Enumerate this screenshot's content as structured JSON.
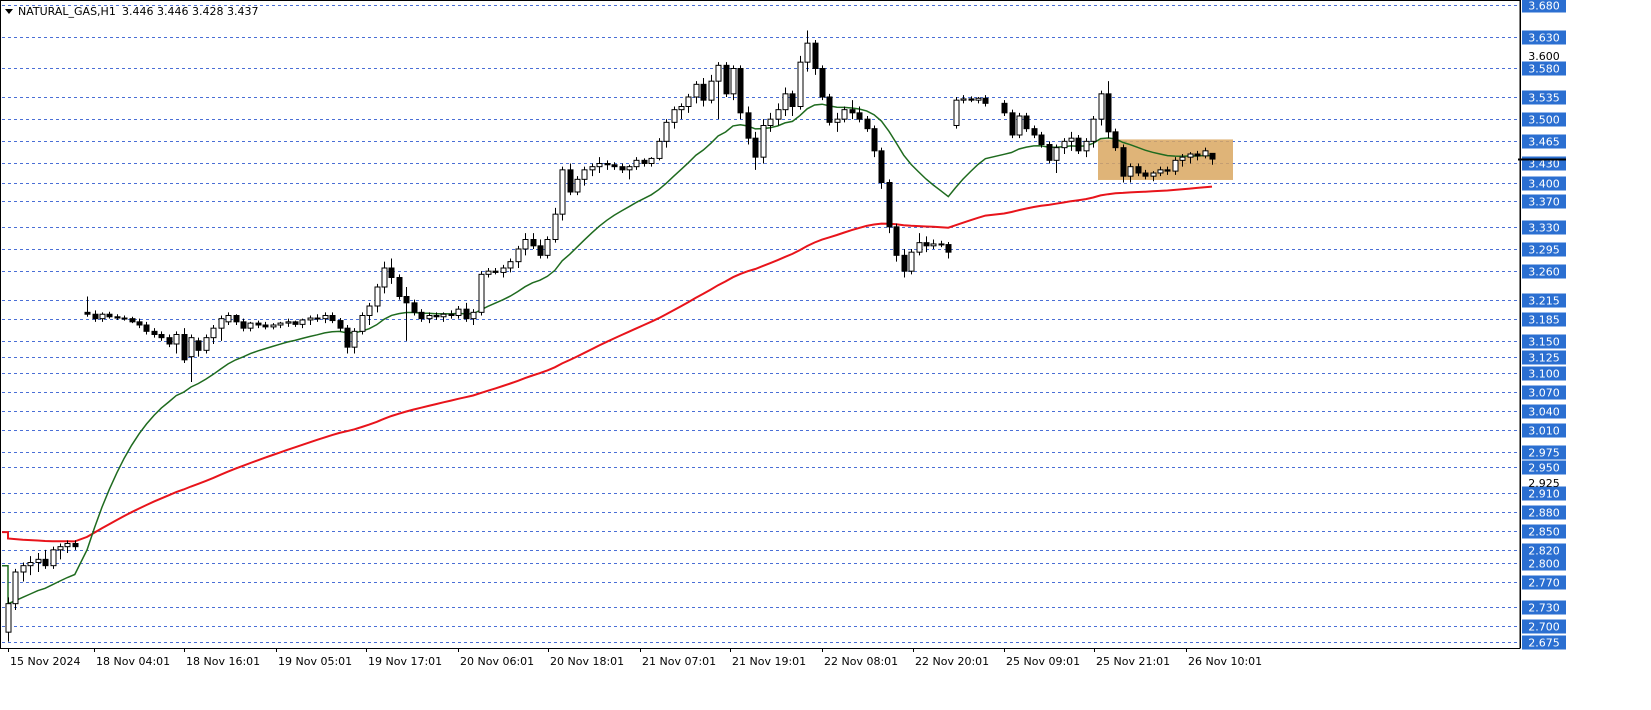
{
  "header": {
    "symbol_label": "NATURAL_GAS,H1",
    "ohlc_values": "3.446 3.446 3.428 3.437"
  },
  "colors": {
    "background": "#ffffff",
    "grid": "#4a6fd6",
    "bull_candle": "#ffffff",
    "bear_candle": "#000000",
    "candle_outline": "#000000",
    "ma_fast": "#1f6b1f",
    "ma_slow": "#e8141b",
    "price_tag_bg": "#2b6fd1",
    "price_tag_text": "#ffffff",
    "zone_fill": "#d9a760"
  },
  "chart_data": {
    "type": "candlestick",
    "instrument": "NATURAL_GAS",
    "timeframe": "H1",
    "ylim": [
      2.665,
      3.685
    ],
    "grid": "horizontal dashed at each price tag",
    "y_ticks_tagged": [
      "3.680",
      "3.630",
      "3.580",
      "3.535",
      "3.500",
      "3.465",
      "3.430",
      "3.400",
      "3.370",
      "3.330",
      "3.295",
      "3.260",
      "3.215",
      "3.185",
      "3.150",
      "3.125",
      "3.100",
      "3.070",
      "3.040",
      "3.010",
      "2.975",
      "2.950",
      "2.910",
      "2.880",
      "2.850",
      "2.820",
      "2.800",
      "2.770",
      "2.730",
      "2.700",
      "2.675"
    ],
    "y_ticks_plain": [
      "3.600",
      "2.925"
    ],
    "x_tick_labels": [
      "15 Nov 2024",
      "18 Nov 04:01",
      "18 Nov 16:01",
      "19 Nov 05:01",
      "19 Nov 17:01",
      "20 Nov 06:01",
      "20 Nov 18:01",
      "21 Nov 07:01",
      "21 Nov 19:01",
      "22 Nov 08:01",
      "22 Nov 20:01",
      "25 Nov 09:01",
      "25 Nov 21:01",
      "26 Nov 10:01"
    ],
    "current_price": "3.437",
    "candles": [
      [
        2.69,
        2.745,
        2.675,
        2.735
      ],
      [
        2.735,
        2.79,
        2.725,
        2.785
      ],
      [
        2.785,
        2.8,
        2.77,
        2.795
      ],
      [
        2.795,
        2.81,
        2.78,
        2.8
      ],
      [
        2.8,
        2.815,
        2.785,
        2.805
      ],
      [
        2.805,
        2.82,
        2.79,
        2.795
      ],
      [
        2.795,
        2.825,
        2.79,
        2.82
      ],
      [
        2.82,
        2.83,
        2.805,
        2.825
      ],
      [
        2.825,
        2.835,
        2.815,
        2.83
      ],
      [
        2.83,
        2.835,
        2.82,
        2.825
      ],
      [
        3.195,
        3.22,
        3.188,
        3.192
      ],
      [
        3.192,
        3.198,
        3.18,
        3.185
      ],
      [
        3.185,
        3.195,
        3.18,
        3.192
      ],
      [
        3.192,
        3.196,
        3.185,
        3.188
      ],
      [
        3.188,
        3.192,
        3.183,
        3.186
      ],
      [
        3.186,
        3.19,
        3.182,
        3.185
      ],
      [
        3.185,
        3.188,
        3.178,
        3.18
      ],
      [
        3.18,
        3.185,
        3.17,
        3.175
      ],
      [
        3.175,
        3.18,
        3.16,
        3.165
      ],
      [
        3.165,
        3.17,
        3.155,
        3.16
      ],
      [
        3.16,
        3.165,
        3.15,
        3.155
      ],
      [
        3.155,
        3.16,
        3.14,
        3.145
      ],
      [
        3.145,
        3.165,
        3.13,
        3.16
      ],
      [
        3.16,
        3.17,
        3.115,
        3.12
      ],
      [
        3.125,
        3.16,
        3.085,
        3.155
      ],
      [
        3.15,
        3.155,
        3.125,
        3.135
      ],
      [
        3.135,
        3.16,
        3.13,
        3.155
      ],
      [
        3.155,
        3.175,
        3.145,
        3.17
      ],
      [
        3.17,
        3.19,
        3.15,
        3.185
      ],
      [
        3.18,
        3.195,
        3.175,
        3.19
      ],
      [
        3.19,
        3.192,
        3.175,
        3.18
      ],
      [
        3.18,
        3.185,
        3.165,
        3.17
      ],
      [
        3.17,
        3.18,
        3.165,
        3.178
      ],
      [
        3.178,
        3.182,
        3.17,
        3.175
      ],
      [
        3.175,
        3.18,
        3.168,
        3.172
      ],
      [
        3.172,
        3.178,
        3.168,
        3.175
      ],
      [
        3.175,
        3.18,
        3.17,
        3.178
      ],
      [
        3.178,
        3.185,
        3.172,
        3.18
      ],
      [
        3.18,
        3.182,
        3.172,
        3.176
      ],
      [
        3.176,
        3.185,
        3.17,
        3.183
      ],
      [
        3.183,
        3.19,
        3.175,
        3.186
      ],
      [
        3.186,
        3.192,
        3.18,
        3.185
      ],
      [
        3.185,
        3.195,
        3.178,
        3.19
      ],
      [
        3.19,
        3.195,
        3.178,
        3.182
      ],
      [
        3.182,
        3.186,
        3.165,
        3.17
      ],
      [
        3.17,
        3.175,
        3.13,
        3.14
      ],
      [
        3.14,
        3.17,
        3.13,
        3.165
      ],
      [
        3.165,
        3.195,
        3.16,
        3.19
      ],
      [
        3.19,
        3.21,
        3.175,
        3.205
      ],
      [
        3.205,
        3.24,
        3.195,
        3.235
      ],
      [
        3.235,
        3.275,
        3.225,
        3.265
      ],
      [
        3.265,
        3.28,
        3.24,
        3.25
      ],
      [
        3.25,
        3.255,
        3.215,
        3.22
      ],
      [
        3.22,
        3.235,
        3.15,
        3.21
      ],
      [
        3.21,
        3.215,
        3.19,
        3.195
      ],
      [
        3.195,
        3.2,
        3.18,
        3.185
      ],
      [
        3.185,
        3.195,
        3.178,
        3.19
      ],
      [
        3.19,
        3.195,
        3.183,
        3.188
      ],
      [
        3.188,
        3.195,
        3.18,
        3.192
      ],
      [
        3.192,
        3.198,
        3.185,
        3.19
      ],
      [
        3.19,
        3.205,
        3.185,
        3.2
      ],
      [
        3.2,
        3.21,
        3.18,
        3.185
      ],
      [
        3.185,
        3.2,
        3.175,
        3.195
      ],
      [
        3.195,
        3.26,
        3.19,
        3.255
      ],
      [
        3.255,
        3.265,
        3.25,
        3.26
      ],
      [
        3.26,
        3.265,
        3.255,
        3.258
      ],
      [
        3.258,
        3.27,
        3.25,
        3.265
      ],
      [
        3.265,
        3.28,
        3.258,
        3.275
      ],
      [
        3.275,
        3.3,
        3.265,
        3.295
      ],
      [
        3.295,
        3.32,
        3.285,
        3.31
      ],
      [
        3.31,
        3.32,
        3.295,
        3.3
      ],
      [
        3.3,
        3.31,
        3.28,
        3.285
      ],
      [
        3.285,
        3.315,
        3.28,
        3.31
      ],
      [
        3.31,
        3.36,
        3.305,
        3.35
      ],
      [
        3.35,
        3.425,
        3.34,
        3.42
      ],
      [
        3.42,
        3.43,
        3.38,
        3.385
      ],
      [
        3.385,
        3.41,
        3.38,
        3.405
      ],
      [
        3.405,
        3.425,
        3.395,
        3.42
      ],
      [
        3.42,
        3.43,
        3.41,
        3.425
      ],
      [
        3.425,
        3.44,
        3.415,
        3.43
      ],
      [
        3.43,
        3.435,
        3.42,
        3.428
      ],
      [
        3.428,
        3.432,
        3.42,
        3.425
      ],
      [
        3.425,
        3.43,
        3.415,
        3.42
      ],
      [
        3.42,
        3.428,
        3.405,
        3.425
      ],
      [
        3.425,
        3.44,
        3.42,
        3.435
      ],
      [
        3.435,
        3.438,
        3.425,
        3.43
      ],
      [
        3.43,
        3.44,
        3.425,
        3.438
      ],
      [
        3.438,
        3.47,
        3.435,
        3.465
      ],
      [
        3.465,
        3.5,
        3.455,
        3.495
      ],
      [
        3.495,
        3.52,
        3.485,
        3.515
      ],
      [
        3.515,
        3.525,
        3.5,
        3.52
      ],
      [
        3.52,
        3.54,
        3.51,
        3.535
      ],
      [
        3.535,
        3.56,
        3.525,
        3.555
      ],
      [
        3.555,
        3.565,
        3.52,
        3.53
      ],
      [
        3.53,
        3.57,
        3.525,
        3.56
      ],
      [
        3.56,
        3.59,
        3.5,
        3.585
      ],
      [
        3.585,
        3.59,
        3.535,
        3.54
      ],
      [
        3.54,
        3.585,
        3.53,
        3.58
      ],
      [
        3.58,
        3.585,
        3.5,
        3.51
      ],
      [
        3.51,
        3.52,
        3.46,
        3.47
      ],
      [
        3.47,
        3.48,
        3.42,
        3.44
      ],
      [
        3.44,
        3.5,
        3.43,
        3.49
      ],
      [
        3.49,
        3.51,
        3.48,
        3.5
      ],
      [
        3.5,
        3.525,
        3.49,
        3.515
      ],
      [
        3.515,
        3.55,
        3.505,
        3.54
      ],
      [
        3.54,
        3.545,
        3.505,
        3.52
      ],
      [
        3.52,
        3.6,
        3.515,
        3.59
      ],
      [
        3.59,
        3.64,
        3.575,
        3.62
      ],
      [
        3.62,
        3.625,
        3.57,
        3.58
      ],
      [
        3.58,
        3.585,
        3.53,
        3.535
      ],
      [
        3.535,
        3.54,
        3.49,
        3.495
      ],
      [
        3.495,
        3.51,
        3.48,
        3.5
      ],
      [
        3.5,
        3.52,
        3.495,
        3.515
      ],
      [
        3.515,
        3.53,
        3.5,
        3.51
      ],
      [
        3.51,
        3.52,
        3.495,
        3.5
      ],
      [
        3.5,
        3.505,
        3.48,
        3.485
      ],
      [
        3.485,
        3.49,
        3.44,
        3.45
      ],
      [
        3.45,
        3.455,
        3.39,
        3.4
      ],
      [
        3.4,
        3.405,
        3.32,
        3.33
      ],
      [
        3.33,
        3.335,
        3.275,
        3.285
      ],
      [
        3.285,
        3.295,
        3.25,
        3.26
      ],
      [
        3.26,
        3.295,
        3.255,
        3.29
      ],
      [
        3.29,
        3.32,
        3.285,
        3.305
      ],
      [
        3.305,
        3.315,
        3.29,
        3.3
      ],
      [
        3.3,
        3.31,
        3.295,
        3.303
      ],
      [
        3.303,
        3.308,
        3.298,
        3.302
      ],
      [
        3.302,
        3.306,
        3.28,
        3.29
      ],
      [
        3.49,
        3.535,
        3.485,
        3.53
      ],
      [
        3.53,
        3.538,
        3.525,
        3.532
      ],
      [
        3.532,
        3.536,
        3.527,
        3.53
      ],
      [
        3.53,
        3.535,
        3.525,
        3.533
      ],
      [
        3.533,
        3.538,
        3.52,
        3.525
      ],
      [
        3.525,
        3.53,
        3.505,
        3.51
      ],
      [
        3.51,
        3.515,
        3.47,
        3.475
      ],
      [
        3.475,
        3.51,
        3.47,
        3.505
      ],
      [
        3.505,
        3.51,
        3.48,
        3.485
      ],
      [
        3.485,
        3.49,
        3.47,
        3.475
      ],
      [
        3.475,
        3.48,
        3.455,
        3.46
      ],
      [
        3.46,
        3.465,
        3.43,
        3.435
      ],
      [
        3.435,
        3.46,
        3.415,
        3.455
      ],
      [
        3.455,
        3.47,
        3.445,
        3.465
      ],
      [
        3.465,
        3.48,
        3.45,
        3.47
      ],
      [
        3.47,
        3.475,
        3.445,
        3.45
      ],
      [
        3.45,
        3.47,
        3.44,
        3.465
      ],
      [
        3.465,
        3.505,
        3.455,
        3.5
      ],
      [
        3.5,
        3.545,
        3.49,
        3.54
      ],
      [
        3.54,
        3.56,
        3.47,
        3.48
      ],
      [
        3.48,
        3.485,
        3.45,
        3.455
      ],
      [
        3.455,
        3.46,
        3.4,
        3.41
      ],
      [
        3.41,
        3.43,
        3.4,
        3.425
      ],
      [
        3.425,
        3.43,
        3.41,
        3.415
      ],
      [
        3.415,
        3.42,
        3.405,
        3.41
      ],
      [
        3.41,
        3.418,
        3.402,
        3.415
      ],
      [
        3.415,
        3.425,
        3.41,
        3.42
      ],
      [
        3.42,
        3.425,
        3.412,
        3.418
      ],
      [
        3.418,
        3.44,
        3.412,
        3.435
      ],
      [
        3.435,
        3.445,
        3.425,
        3.44
      ],
      [
        3.44,
        3.448,
        3.43,
        3.445
      ],
      [
        3.445,
        3.45,
        3.435,
        3.442
      ],
      [
        3.442,
        3.455,
        3.438,
        3.45
      ],
      [
        3.446,
        3.446,
        3.428,
        3.437
      ]
    ]
  }
}
